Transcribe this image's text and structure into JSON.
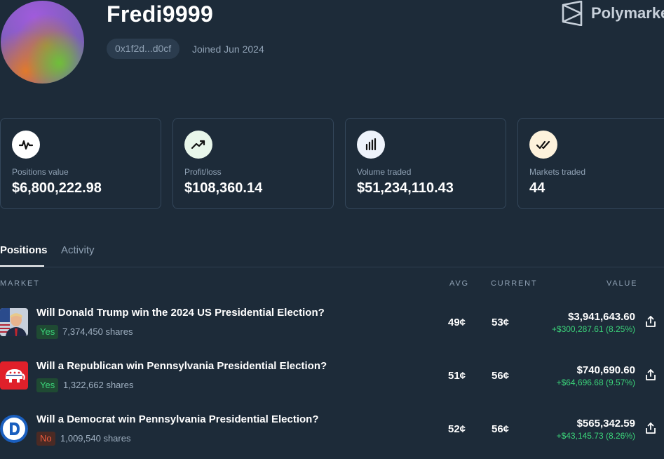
{
  "profile": {
    "username": "Fredi9999",
    "address": "0x1f2d...d0cf",
    "joined": "Joined Jun 2024"
  },
  "brand": {
    "name": "Polymarket",
    "icon": "polymarket-logo-icon"
  },
  "stats": [
    {
      "label": "Positions value",
      "value": "$6,800,222.98",
      "icon": "activity-pulse-icon"
    },
    {
      "label": "Profit/loss",
      "value": "$108,360.14",
      "icon": "trending-up-icon"
    },
    {
      "label": "Volume traded",
      "value": "$51,234,110.43",
      "icon": "bar-chart-icon"
    },
    {
      "label": "Markets traded",
      "value": "44",
      "icon": "double-check-icon"
    }
  ],
  "tabs": {
    "positions": "Positions",
    "activity": "Activity"
  },
  "columns": {
    "market": "MARKET",
    "avg": "AVG",
    "current": "CURRENT",
    "value": "VALUE"
  },
  "positions": [
    {
      "title": "Will Donald Trump win the 2024 US Presidential Election?",
      "outcome": "Yes",
      "shares": "7,374,450 shares",
      "avg": "49¢",
      "current": "53¢",
      "value": "$3,941,643.60",
      "pnl": "+$300,287.61 (8.25%)",
      "image": "trump-portrait"
    },
    {
      "title": "Will a Republican win Pennsylvania Presidential Election?",
      "outcome": "Yes",
      "shares": "1,322,662 shares",
      "avg": "51¢",
      "current": "56¢",
      "value": "$740,690.60",
      "pnl": "+$64,696.68 (9.57%)",
      "image": "republican-elephant-logo"
    },
    {
      "title": "Will a Democrat win Pennsylvania Presidential Election?",
      "outcome": "No",
      "shares": "1,009,540 shares",
      "avg": "52¢",
      "current": "56¢",
      "value": "$565,342.59",
      "pnl": "+$43,145.73 (8.26%)",
      "image": "democrat-d-logo"
    }
  ]
}
